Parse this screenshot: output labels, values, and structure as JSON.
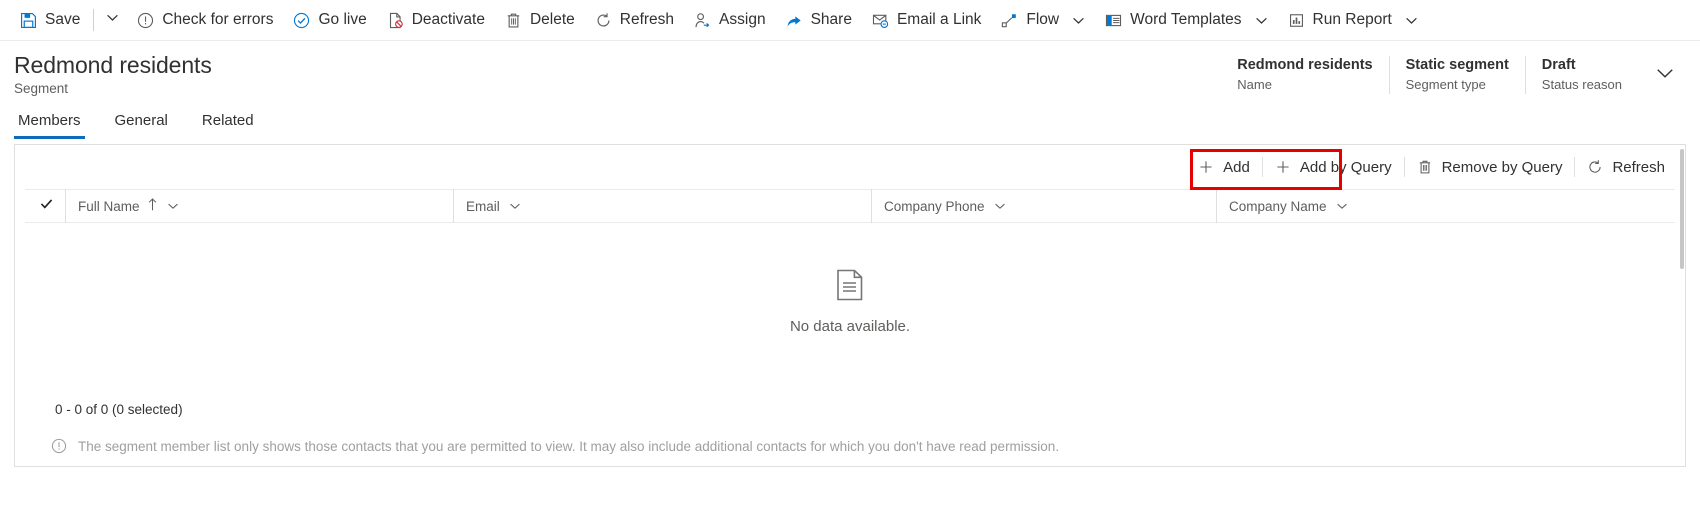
{
  "toolbar": {
    "items": [
      {
        "label": "Save",
        "icon": "save-icon"
      },
      {
        "label": "",
        "icon": "chevron-down-icon"
      },
      {
        "label": "Check for errors",
        "icon": "exclamation-circle-icon"
      },
      {
        "label": "Go live",
        "icon": "check-circle-icon"
      },
      {
        "label": "Deactivate",
        "icon": "deactivate-icon"
      },
      {
        "label": "Delete",
        "icon": "trash-icon"
      },
      {
        "label": "Refresh",
        "icon": "refresh-icon"
      },
      {
        "label": "Assign",
        "icon": "assign-person-icon"
      },
      {
        "label": "Share",
        "icon": "share-icon"
      },
      {
        "label": "Email a Link",
        "icon": "email-link-icon"
      },
      {
        "label": "Flow",
        "icon": "flow-icon"
      },
      {
        "label": "Word Templates",
        "icon": "word-template-icon"
      },
      {
        "label": "Run Report",
        "icon": "run-report-icon"
      }
    ]
  },
  "header": {
    "title": "Redmond residents",
    "subtitle": "Segment",
    "fields": [
      {
        "value": "Redmond residents",
        "label": "Name"
      },
      {
        "value": "Static segment",
        "label": "Segment type"
      },
      {
        "value": "Draft",
        "label": "Status reason"
      }
    ],
    "collapse_icon": "chevron-down-icon"
  },
  "tabs": [
    {
      "label": "Members",
      "active": true
    },
    {
      "label": "General",
      "active": false
    },
    {
      "label": "Related",
      "active": false
    }
  ],
  "grid": {
    "commands": [
      {
        "label": "Add",
        "icon": "plus-icon",
        "highlighted": false
      },
      {
        "label": "Add by Query",
        "icon": "plus-icon",
        "highlighted": true
      },
      {
        "label": "Remove by Query",
        "icon": "trash-icon",
        "highlighted": false
      },
      {
        "label": "Refresh",
        "icon": "refresh-icon",
        "highlighted": false
      }
    ],
    "select_all_icon": "checkmark-icon",
    "columns": [
      {
        "label": "Full Name",
        "sorted": true,
        "sort_icon": "arrow-up-icon",
        "menu_icon": "chevron-down-icon"
      },
      {
        "label": "Email",
        "sorted": false,
        "menu_icon": "chevron-down-icon"
      },
      {
        "label": "Company Phone",
        "sorted": false,
        "menu_icon": "chevron-down-icon"
      },
      {
        "label": "Company Name",
        "sorted": false,
        "menu_icon": "chevron-down-icon"
      }
    ],
    "empty_state": {
      "icon": "document-icon",
      "text": "No data available."
    },
    "record_count": "0 - 0 of 0 (0 selected)",
    "note": {
      "icon": "info-circle-icon",
      "text": "The segment member list only shows those contacts that you are permitted to view. It may also include additional contacts for which you don't have read permission."
    }
  },
  "colors": {
    "accent": "#0078d4",
    "tab_active": "#0f6cbd",
    "annotation": "#e60000",
    "text": "#323130",
    "muted": "#605e5c"
  }
}
